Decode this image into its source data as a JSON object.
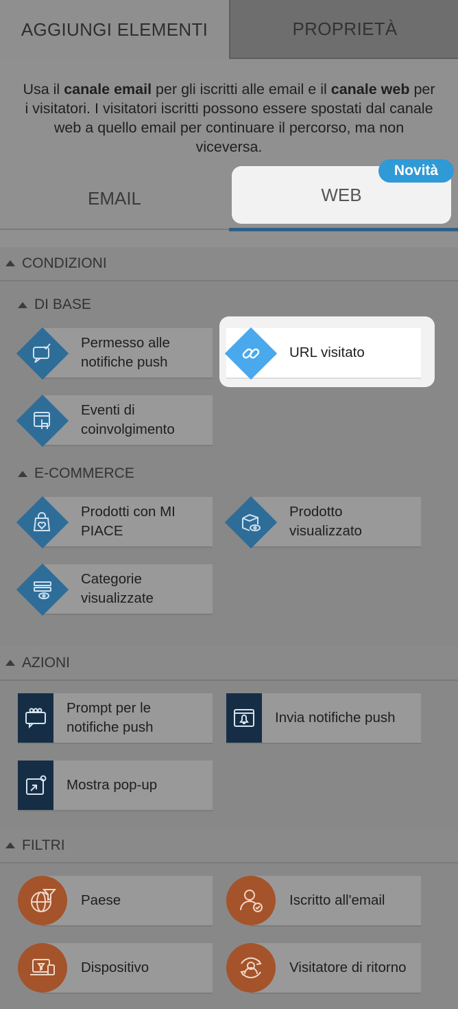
{
  "tabs": {
    "add": "AGGIUNGI ELEMENTI",
    "properties": "PROPRIETÀ"
  },
  "intro": {
    "p1": "Usa il ",
    "b1": "canale email",
    "p2": " per gli iscritti alle email e il ",
    "b2": "canale web",
    "p3": " per i visitatori. I visitatori iscritti possono essere spostati dal canale web a quello email per continuare il percorso, ma non viceversa."
  },
  "channels": {
    "email": "EMAIL",
    "web": "WEB",
    "badge": "Novità"
  },
  "conditions": {
    "title": "CONDIZIONI",
    "basic": {
      "title": "DI BASE",
      "items": [
        {
          "label": "Permesso alle notifiche push",
          "icon": "chat-check-icon"
        },
        {
          "label": "URL visitato",
          "icon": "link-icon"
        },
        {
          "label": "Eventi di coinvolgimento",
          "icon": "tap-icon"
        }
      ]
    },
    "ecommerce": {
      "title": "E-COMMERCE",
      "items": [
        {
          "label": "Prodotti con MI PIACE",
          "icon": "bag-heart-icon"
        },
        {
          "label": "Prodotto visualizzato",
          "icon": "box-eye-icon"
        },
        {
          "label": "Categorie visualizzate",
          "icon": "list-eye-icon"
        }
      ]
    }
  },
  "actions": {
    "title": "AZIONI",
    "items": [
      {
        "label": "Prompt per le notifiche push",
        "icon": "prompt-icon"
      },
      {
        "label": "Invia notifiche push",
        "icon": "bell-window-icon"
      },
      {
        "label": "Mostra pop-up",
        "icon": "popup-icon"
      }
    ]
  },
  "filters": {
    "title": "FILTRI",
    "items": [
      {
        "label": "Paese",
        "icon": "globe-filter-icon"
      },
      {
        "label": "Iscritto all'email",
        "icon": "user-check-icon"
      },
      {
        "label": "Dispositivo",
        "icon": "device-icon"
      },
      {
        "label": "Visitatore di ritorno",
        "icon": "user-return-icon"
      }
    ]
  },
  "colors": {
    "background": "#909090",
    "accent_blue": "#2f6d99",
    "highlight_blue": "#4aa8ec",
    "badge_blue": "#2f9ad6",
    "action_navy": "#162e45",
    "filter_orange": "#a4532a"
  }
}
